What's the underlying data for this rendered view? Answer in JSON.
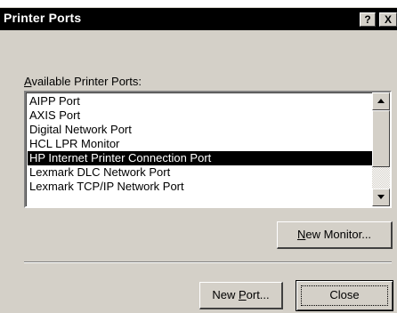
{
  "window": {
    "title": "Printer Ports",
    "help_button": "?",
    "close_button": "X"
  },
  "list": {
    "label_mnemonic": "A",
    "label_rest": "vailable Printer Ports:",
    "items": [
      "AIPP Port",
      "AXIS Port",
      "Digital Network Port",
      "HCL LPR Monitor",
      "HP Internet Printer Connection Port",
      "Lexmark DLC Network Port",
      "Lexmark TCP/IP Network Port"
    ],
    "selected": "HP Internet Printer Connection Port"
  },
  "buttons": {
    "new_monitor_mnemonic": "N",
    "new_monitor_rest": "ew Monitor...",
    "new_port_pre": "New ",
    "new_port_mnemonic": "P",
    "new_port_post": "ort...",
    "close": "Close"
  },
  "colors": {
    "dialog_face": "#d4d0c8",
    "title_bar": "#000000",
    "selection": "#000000"
  }
}
